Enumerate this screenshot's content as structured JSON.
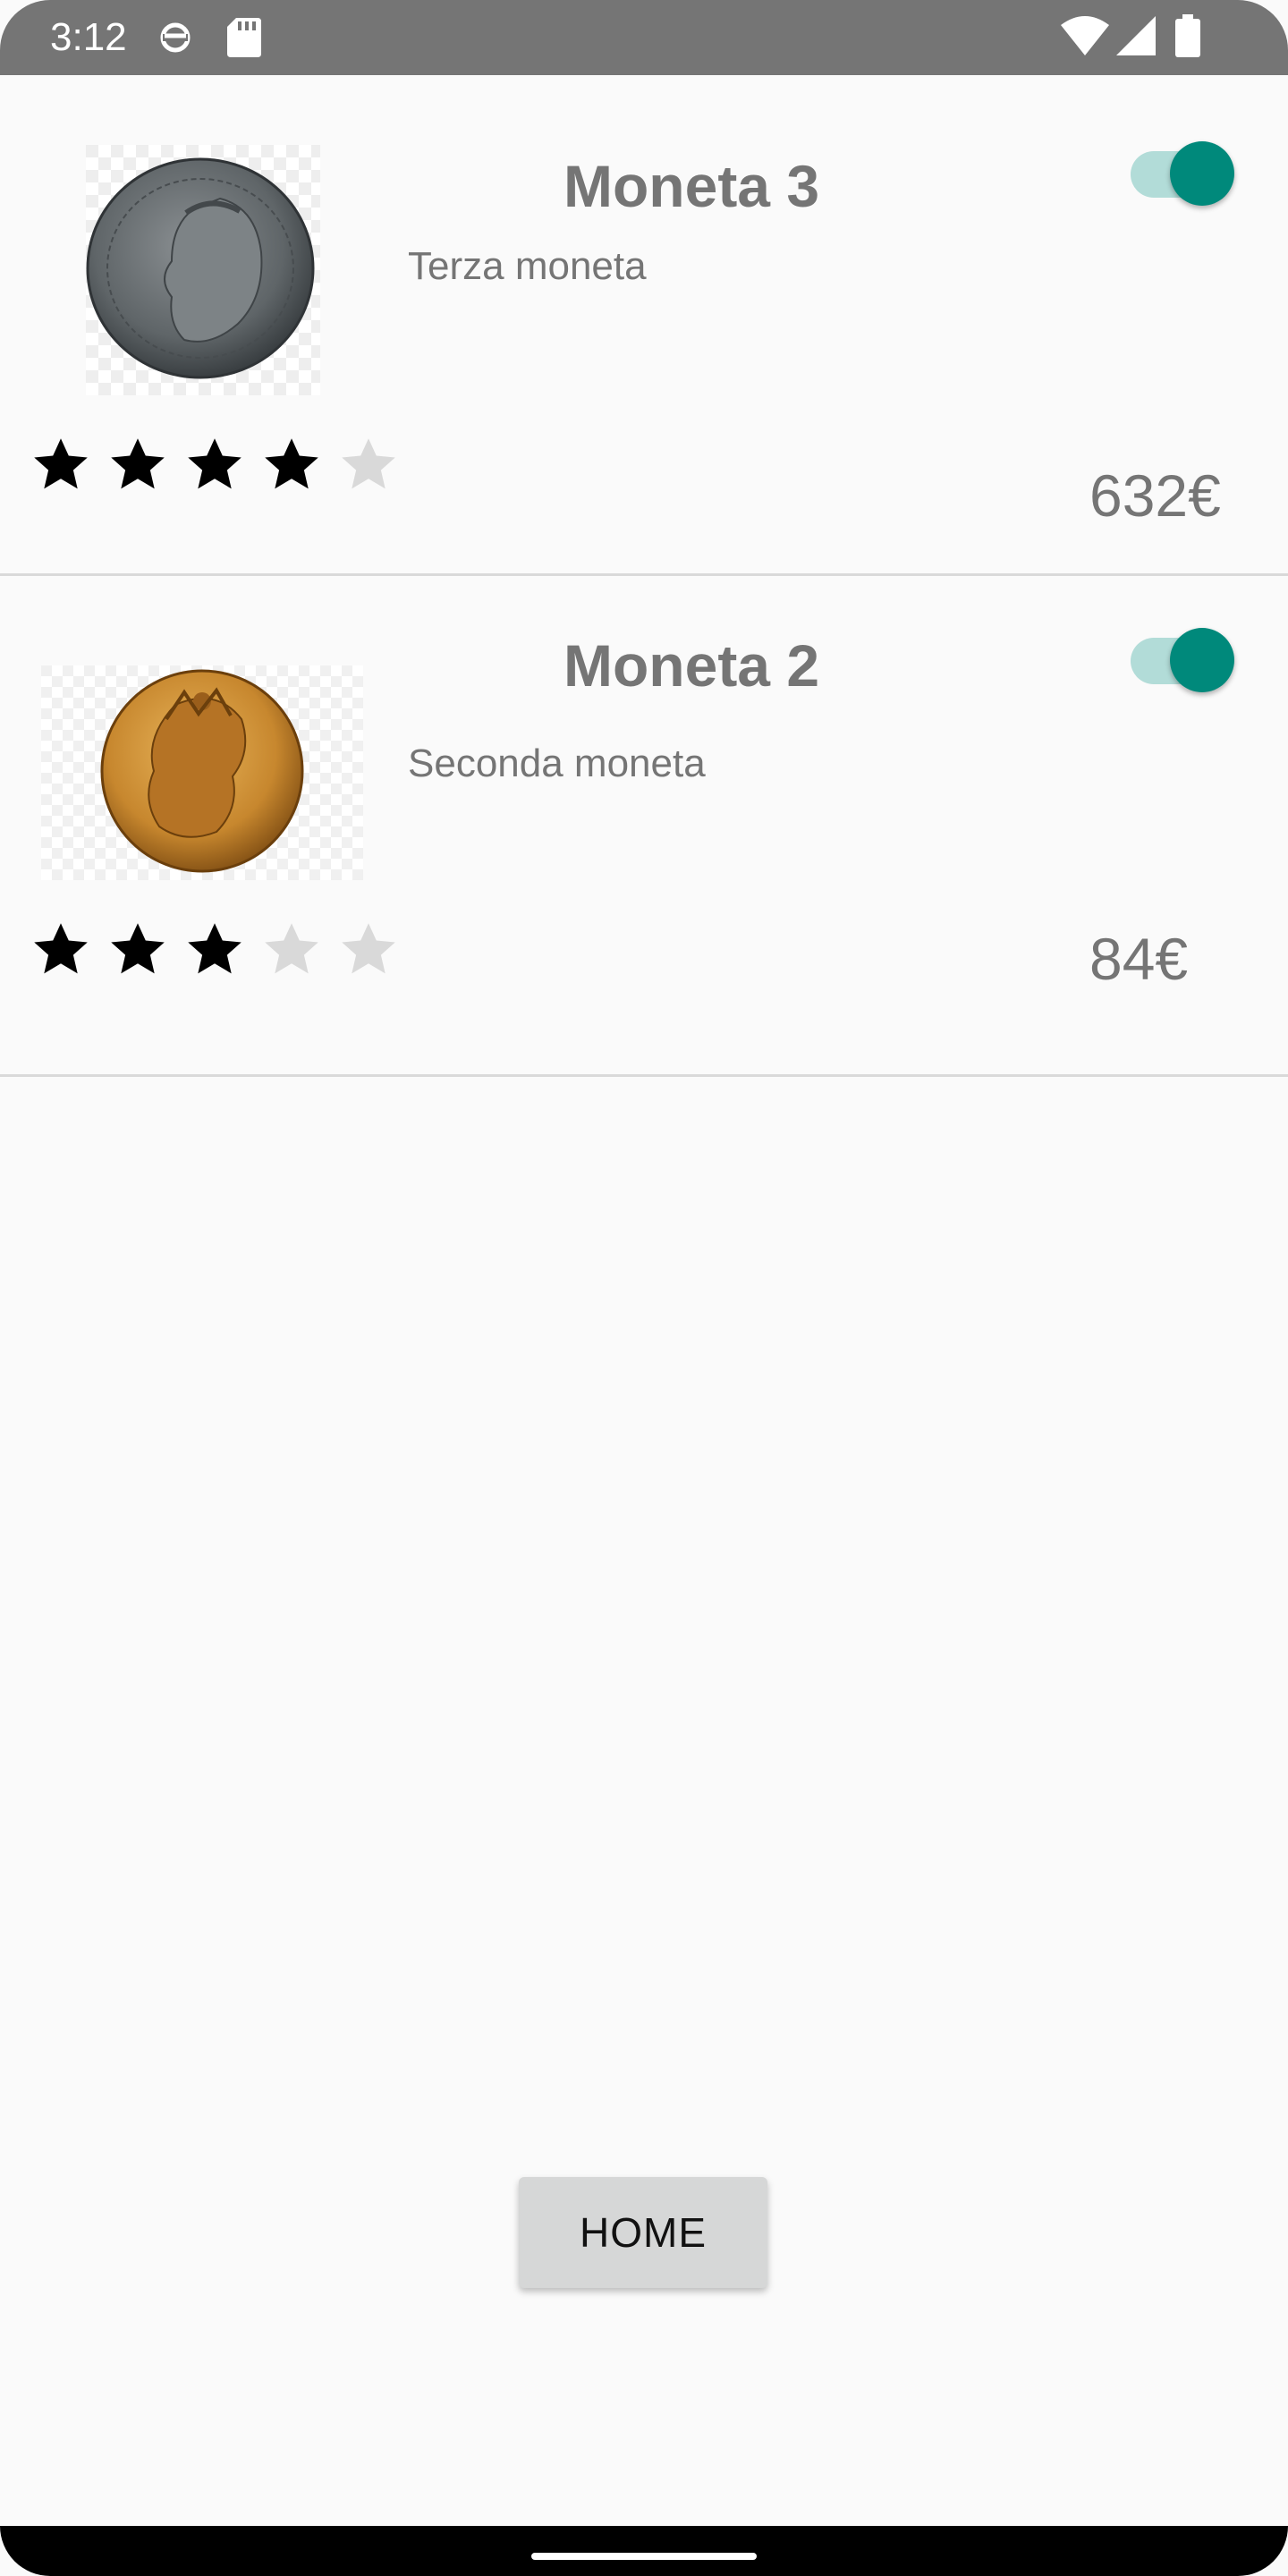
{
  "status_bar": {
    "time": "3:12",
    "icons": [
      "sync-icon",
      "sd-card-icon",
      "wifi-icon",
      "cell-signal-icon",
      "battery-icon"
    ]
  },
  "colors": {
    "accent": "#00897b",
    "text_gray": "#757575",
    "star_filled": "#000000",
    "star_empty": "#d9d9d9"
  },
  "coins": [
    {
      "title": "Moneta 3",
      "description": "Terza moneta",
      "price": "632€",
      "rating": 4,
      "max_rating": 5,
      "enabled": true,
      "image_icon": "silver-coin-image"
    },
    {
      "title": "Moneta 2",
      "description": "Seconda moneta",
      "price": "84€",
      "rating": 3,
      "max_rating": 5,
      "enabled": true,
      "image_icon": "gold-coin-image"
    }
  ],
  "home_button": {
    "label": "HOME"
  }
}
